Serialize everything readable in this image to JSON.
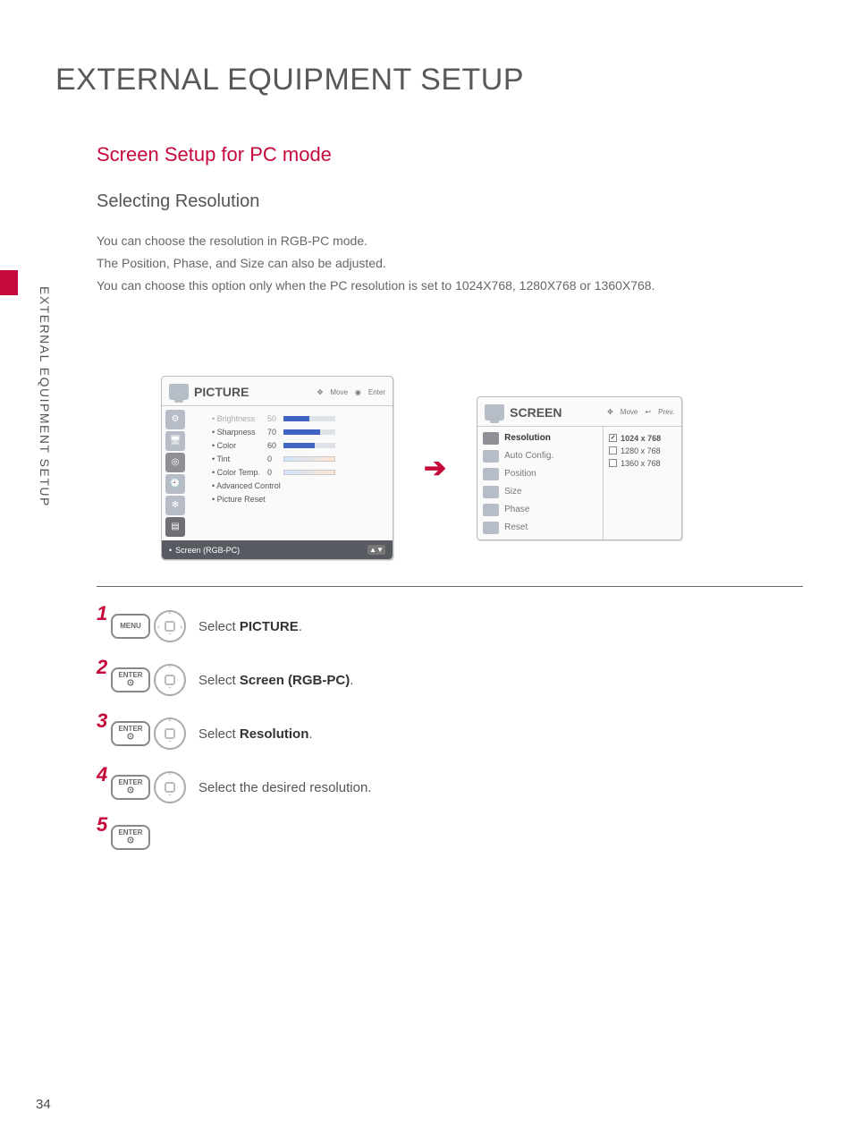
{
  "page_number": "34",
  "side_label": "EXTERNAL EQUIPMENT SETUP",
  "title": "EXTERNAL EQUIPMENT SETUP",
  "section_title": "Screen Setup for PC mode",
  "subsection_title": "Selecting Resolution",
  "body_lines": [
    "You can choose the resolution in RGB-PC mode.",
    "The Position, Phase, and Size can also be adjusted.",
    "You can choose this option only when the PC resolution is set to 1024X768, 1280X768 or 1360X768."
  ],
  "picture_panel": {
    "title": "PICTURE",
    "nav_move": "Move",
    "nav_enter": "Enter",
    "items": [
      {
        "label": "Brightness",
        "value": "50",
        "fill": 50,
        "dim": true
      },
      {
        "label": "Sharpness",
        "value": "70",
        "fill": 70
      },
      {
        "label": "Color",
        "value": "60",
        "fill": 60
      },
      {
        "label": "Tint",
        "value": "0",
        "center": true
      },
      {
        "label": "Color Temp.",
        "value": "0",
        "center": true
      }
    ],
    "extra": [
      "Advanced Control",
      "Picture Reset"
    ],
    "footer": "Screen (RGB-PC)"
  },
  "screen_panel": {
    "title": "SCREEN",
    "nav_move": "Move",
    "nav_prev": "Prev.",
    "menu": [
      "Resolution",
      "Auto Config.",
      "Position",
      "Size",
      "Phase",
      "Reset"
    ],
    "resolutions": [
      {
        "label": "1024 x 768",
        "selected": true
      },
      {
        "label": "1280 x 768",
        "selected": false
      },
      {
        "label": "1360 x 768",
        "selected": false
      }
    ]
  },
  "steps": [
    {
      "n": "1",
      "key": "MENU",
      "nav": "lr",
      "pre": "Select ",
      "bold": "PICTURE",
      "post": "."
    },
    {
      "n": "2",
      "key": "ENTER",
      "nav": "ud",
      "pre": "Select ",
      "bold": "Screen (RGB-PC)",
      "post": "."
    },
    {
      "n": "3",
      "key": "ENTER",
      "nav": "ud",
      "pre": "Select ",
      "bold": "Resolution",
      "post": "."
    },
    {
      "n": "4",
      "key": "ENTER",
      "nav": "ud",
      "pre": "Select the desired resolution.",
      "bold": "",
      "post": ""
    },
    {
      "n": "5",
      "key": "ENTER",
      "nav": "",
      "pre": "",
      "bold": "",
      "post": ""
    }
  ],
  "chart_data": {
    "type": "bar",
    "title": "Picture menu sliders",
    "categories": [
      "Brightness",
      "Sharpness",
      "Color",
      "Tint",
      "Color Temp."
    ],
    "values": [
      50,
      70,
      60,
      0,
      0
    ],
    "xlabel": "",
    "ylabel": "",
    "ylim": [
      0,
      100
    ]
  }
}
